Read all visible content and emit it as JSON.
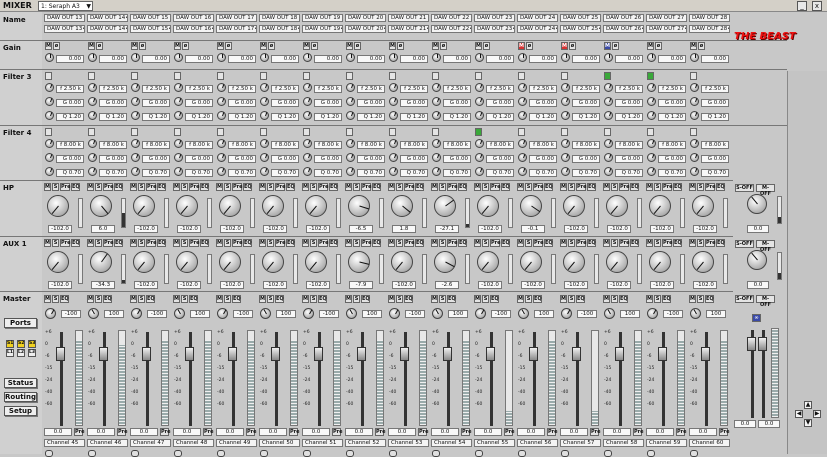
{
  "titlebar": {
    "title": "MIXER",
    "device": "1: Seraph A3",
    "close_glyph": "x"
  },
  "rows": {
    "name": "Name",
    "gain": "Gain",
    "filter3": "Filter 3",
    "filter4": "Filter 4",
    "hp": "HP",
    "aux1": "AUX 1",
    "master": "Master"
  },
  "side_buttons": {
    "ports": "Ports",
    "status": "Status",
    "routing": "Routing",
    "setup": "Setup"
  },
  "side_toggles": [
    "S1",
    "S2",
    "S3",
    "L1",
    "L2",
    "L3"
  ],
  "logo": "THE BEAST",
  "button_labels": {
    "mute": "M",
    "phase": "ø",
    "solo": "S",
    "pre": "Pre",
    "eq": "EQ",
    "mute_w": "M",
    "sw_off": "S-OFF",
    "m_off": "M-OFF"
  },
  "filter3": {
    "freq": "f 2.50 k",
    "gain": "G 0.00",
    "q": "Q 1.20"
  },
  "filter4": {
    "freq": "f 8.00 k",
    "gain": "G 0.00",
    "q": "Q 0.70"
  },
  "gain_value": "0.00",
  "master_pan_left": "-100",
  "master_pan_right": "100",
  "fader_scale": [
    "+6",
    "0",
    "-6",
    "-15",
    "-24",
    "-40",
    "-60"
  ],
  "channels": [
    {
      "top": "DAW OUT 13",
      "bot": "DAW OUT 13•",
      "hp": "-102.0",
      "aux": "-102.0",
      "hpm": 0.0,
      "auxm": 0.0,
      "fv": "0.0",
      "label": "Channel 45",
      "gm": "",
      "meter": 0.9
    },
    {
      "top": "DAW OUT 14•",
      "bot": "DAW OUT 14•",
      "hp": "6.0",
      "aux": "-34.3",
      "hpm": 0.5,
      "auxm": 0.1,
      "fv": "0.0",
      "label": "Channel 46",
      "gm": "",
      "meter": 0.85
    },
    {
      "top": "DAW OUT 15",
      "bot": "DAW OUT 15•",
      "hp": "-102.0",
      "aux": "-102.0",
      "hpm": 0,
      "auxm": 0,
      "fv": "0.0",
      "label": "Channel 47",
      "gm": "",
      "meter": 0.9
    },
    {
      "top": "DAW OUT 16",
      "bot": "DAW OUT 16•",
      "hp": "-102.0",
      "aux": "-102.0",
      "hpm": 0,
      "auxm": 0,
      "fv": "0.0",
      "label": "Channel 48",
      "gm": "",
      "meter": 0.9
    },
    {
      "top": "DAW OUT 17",
      "bot": "DAW OUT 17•",
      "hp": "-102.0",
      "aux": "-102.0",
      "hpm": 0,
      "auxm": 0,
      "fv": "0.0",
      "label": "Channel 49",
      "gm": "",
      "meter": 0.9
    },
    {
      "top": "DAW OUT 18",
      "bot": "DAW OUT 18•",
      "hp": "-102.0",
      "aux": "-102.0",
      "hpm": 0,
      "auxm": 0,
      "fv": "0.0",
      "label": "Channel 50",
      "gm": "",
      "meter": 0.9
    },
    {
      "top": "DAW OUT 19",
      "bot": "DAW OUT 19•",
      "hp": "-102.0",
      "aux": "-102.0",
      "hpm": 0,
      "auxm": 0,
      "fv": "0.0",
      "label": "Channel 51",
      "gm": "",
      "meter": 0.9
    },
    {
      "top": "DAW OUT 20",
      "bot": "DAW OUT 20•",
      "hp": "-6.5",
      "aux": "-7.9",
      "hpm": 0,
      "auxm": 0,
      "fv": "0.0",
      "label": "Channel 52",
      "gm": "",
      "meter": 0.9
    },
    {
      "top": "DAW OUT 21",
      "bot": "DAW OUT 21•",
      "hp": "1.8",
      "aux": "-102.0",
      "hpm": 0,
      "auxm": 0,
      "fv": "0.0",
      "label": "Channel 53",
      "gm": "",
      "meter": 0.9
    },
    {
      "top": "DAW OUT 22",
      "bot": "DAW OUT 22•",
      "hp": "-27.1",
      "aux": "-2.6",
      "hpm": 0.1,
      "auxm": 0,
      "fv": "0.0",
      "label": "Channel 54",
      "gm": "",
      "meter": 0.9
    },
    {
      "top": "DAW OUT 23",
      "bot": "DAW OUT 23•",
      "hp": "-102.0",
      "aux": "-102.0",
      "hpm": 0,
      "auxm": 0,
      "fv": "0.0",
      "label": "Channel 55",
      "gm": "",
      "meter": 0.15
    },
    {
      "top": "DAW OUT 24",
      "bot": "DAW OUT 24•",
      "hp": "-0.1",
      "aux": "-102.0",
      "hpm": 0,
      "auxm": 0,
      "fv": "0.0",
      "label": "Channel 56",
      "gm": "red",
      "meter": 0.9
    },
    {
      "top": "DAW OUT 25",
      "bot": "DAW OUT 25•",
      "hp": "-102.0",
      "aux": "-102.0",
      "hpm": 0,
      "auxm": 0,
      "fv": "0.0",
      "label": "Channel 57",
      "gm": "red",
      "meter": 0.15
    },
    {
      "top": "DAW OUT 26",
      "bot": "DAW OUT 26•",
      "hp": "-102.0",
      "aux": "-102.0",
      "hpm": 0,
      "auxm": 0,
      "fv": "0.0",
      "label": "Channel 58",
      "gm": "blue",
      "meter": 0.9
    },
    {
      "top": "DAW OUT 27",
      "bot": "DAW OUT 27•",
      "hp": "-102.0",
      "aux": "-102.0",
      "hpm": 0,
      "auxm": 0,
      "fv": "0.0",
      "label": "Channel 59",
      "gm": "",
      "meter": 0.9
    },
    {
      "top": "DAW OUT 28",
      "bot": "DAW OUT 28•",
      "hp": "-102.0",
      "aux": "-102.0",
      "hpm": 0,
      "auxm": 0,
      "fv": "0.0",
      "label": "Channel 60",
      "gm": "",
      "meter": 0.9
    }
  ],
  "master_strip": {
    "hp": "0.0",
    "aux": "0.0",
    "fv_left": "0.0",
    "fv_right": "0.0"
  },
  "colors": {
    "red": "#d83232",
    "blue": "#3a4aa8",
    "green": "#3aa83a",
    "yellow": "#f0d020"
  }
}
